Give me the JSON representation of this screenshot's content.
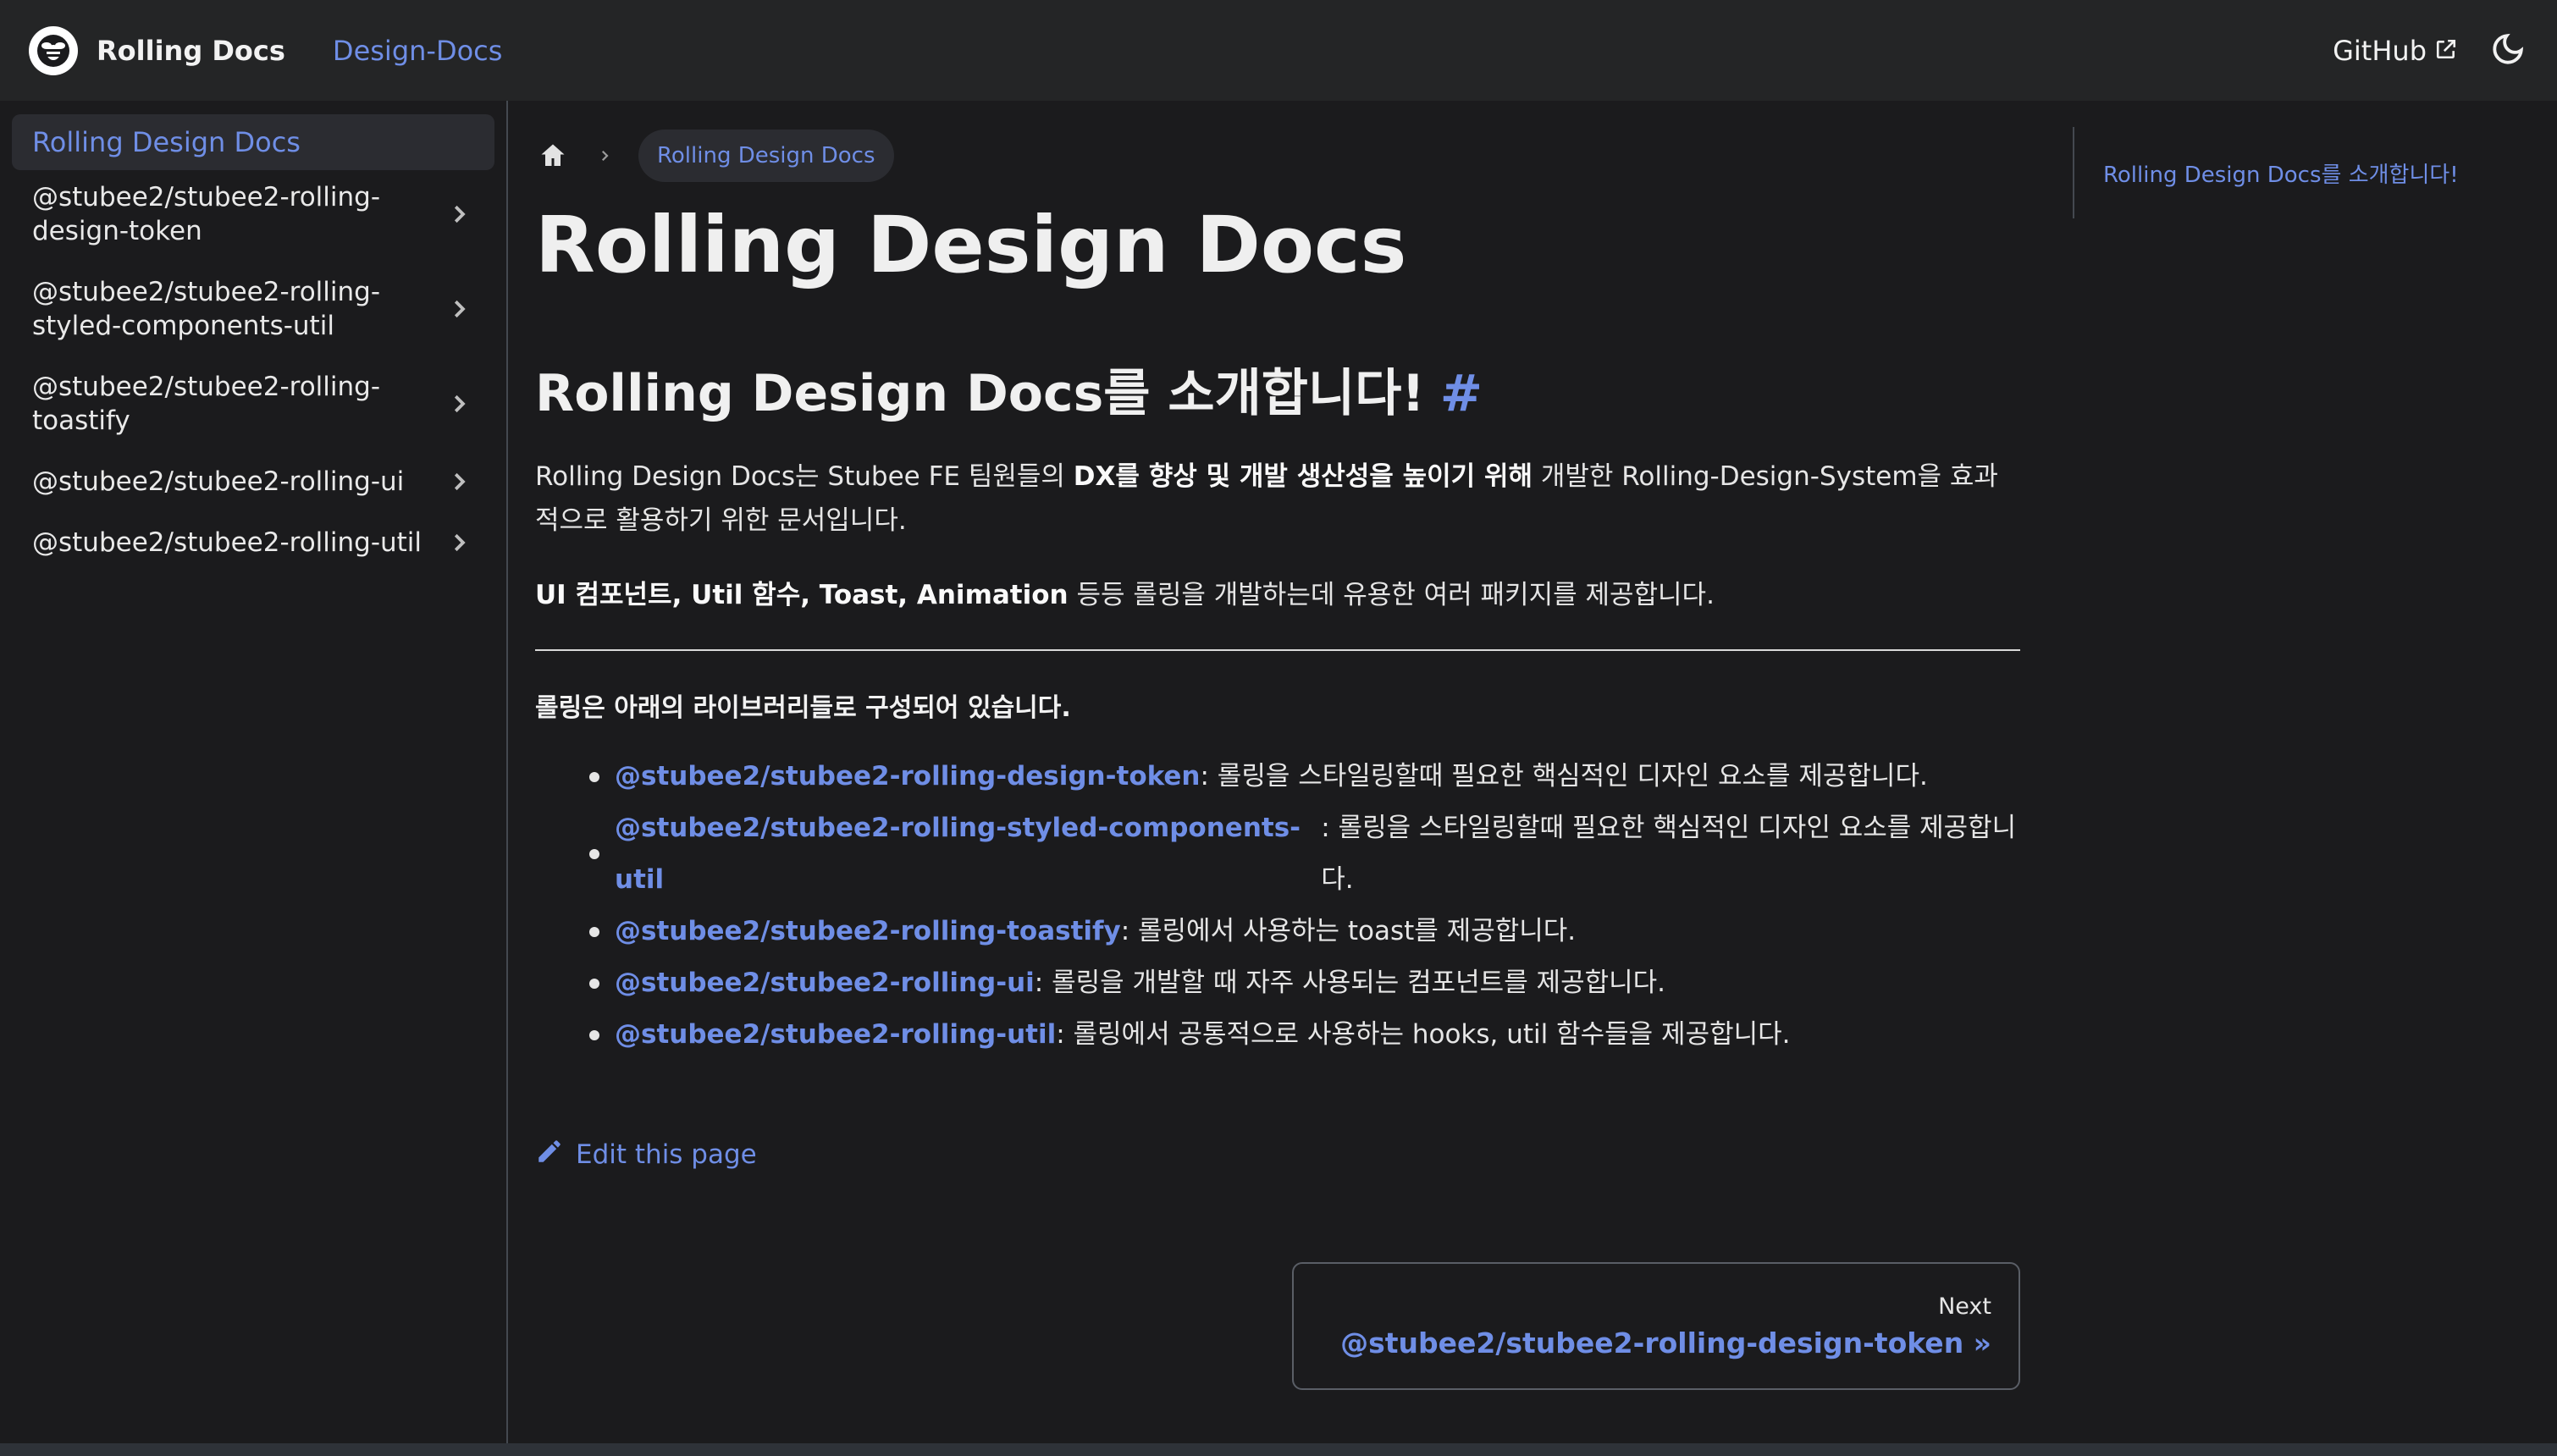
{
  "navbar": {
    "brand": "Rolling Docs",
    "link": "Design-Docs",
    "github": "GitHub"
  },
  "sidebar": {
    "active": "Rolling Design Docs",
    "items": [
      {
        "label": "@stubee2/stubee2-rolling-design-token"
      },
      {
        "label": "@stubee2/stubee2-rolling-styled-components-util"
      },
      {
        "label": "@stubee2/stubee2-rolling-toastify"
      },
      {
        "label": "@stubee2/stubee2-rolling-ui"
      },
      {
        "label": "@stubee2/stubee2-rolling-util"
      }
    ]
  },
  "breadcrumb": {
    "current": "Rolling Design Docs"
  },
  "main": {
    "title": "Rolling Design Docs",
    "h2": "Rolling Design Docs를 소개합니다!",
    "hash": "#",
    "para1_a": "Rolling Design Docs는 Stubee FE 팀원들의 ",
    "para1_b": "DX를 향상 및 개발 생산성을 높이기 위해",
    "para1_c": " 개발한 Rolling-Design-System을 효과적으로 활용하기 위한 문서입니다.",
    "para2_a": "UI 컴포넌트, Util 함수, Toast, Animation",
    "para2_b": " 등등 롤링을 개발하는데 유용한 여러 패키지를 제공합니다.",
    "strong_line": "롤링은 아래의 라이브러리들로 구성되어 있습니다.",
    "list": [
      {
        "link": "@stubee2/stubee2-rolling-design-token",
        "desc": " : 롤링을 스타일링할때 필요한 핵심적인 디자인 요소를 제공합니다."
      },
      {
        "link": "@stubee2/stubee2-rolling-styled-components-util",
        "desc": " : 롤링을 스타일링할때 필요한 핵심적인 디자인 요소를 제공합니다."
      },
      {
        "link": "@stubee2/stubee2-rolling-toastify",
        "desc": " : 롤링에서 사용하는 toast를 제공합니다."
      },
      {
        "link": "@stubee2/stubee2-rolling-ui",
        "desc": " : 롤링을 개발할 때 자주 사용되는 컴포넌트를 제공합니다."
      },
      {
        "link": "@stubee2/stubee2-rolling-util",
        "desc": " : 롤링에서 공통적으로 사용하는 hooks, util 함수들을 제공합니다."
      }
    ],
    "edit": "Edit this page",
    "next_sub": "Next",
    "next_label": "@stubee2/stubee2-rolling-design-token »"
  },
  "toc": {
    "item": "Rolling Design Docs를 소개합니다!"
  },
  "icons": {
    "logo": "bee-logo-icon",
    "external": "external-link-icon",
    "theme": "moon-icon",
    "home": "home-icon",
    "chevron": "chevron-right-icon",
    "edit": "pencil-icon"
  },
  "colors": {
    "link": "#6f8ee6",
    "background": "#1b1b1d",
    "navbar": "#242526"
  }
}
